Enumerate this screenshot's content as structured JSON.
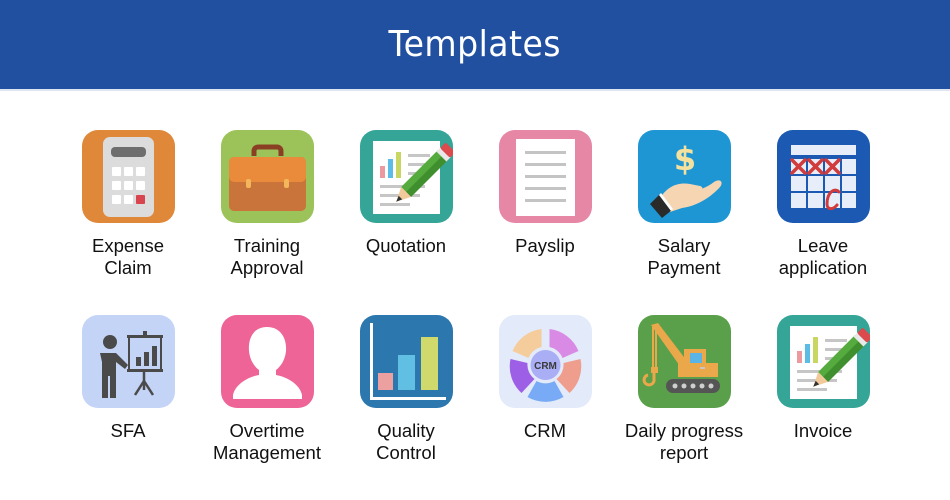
{
  "header": {
    "title": "Templates",
    "background": "#2150a1"
  },
  "templates": [
    {
      "id": "expense-claim",
      "lines": [
        "Expense",
        "Claim"
      ],
      "icon": "calculator-icon",
      "color": "#e0883a"
    },
    {
      "id": "training-approval",
      "lines": [
        "Training",
        "Approval"
      ],
      "icon": "briefcase-icon",
      "color": "#9cc35a"
    },
    {
      "id": "quotation",
      "lines": [
        "Quotation"
      ],
      "icon": "document-pencil-icon",
      "color": "#35a597"
    },
    {
      "id": "payslip",
      "lines": [
        "Payslip"
      ],
      "icon": "document-icon",
      "color": "#e687a6"
    },
    {
      "id": "salary-payment",
      "lines": [
        "Salary",
        "Payment"
      ],
      "icon": "hand-dollar-icon",
      "color": "#1e96d4"
    },
    {
      "id": "leave-application",
      "lines": [
        "Leave",
        "application"
      ],
      "icon": "calendar-icon",
      "color": "#1b59b3"
    },
    {
      "id": "sfa",
      "lines": [
        "SFA"
      ],
      "icon": "presentation-icon",
      "color": "#c4d4f7"
    },
    {
      "id": "overtime-management",
      "lines": [
        "Overtime",
        "Management"
      ],
      "icon": "person-icon",
      "color": "#ee6496"
    },
    {
      "id": "quality-control",
      "lines": [
        "Quality",
        "Control"
      ],
      "icon": "bar-chart-icon",
      "color": "#2b77ae"
    },
    {
      "id": "crm",
      "lines": [
        "CRM"
      ],
      "icon": "crm-wheel-icon",
      "color": "#e3eafa",
      "icon_text": "CRM"
    },
    {
      "id": "daily-progress-report",
      "lines": [
        "Daily progress",
        "report"
      ],
      "icon": "crane-icon",
      "color": "#5aa04a"
    },
    {
      "id": "invoice",
      "lines": [
        "Invoice"
      ],
      "icon": "document-pencil-icon",
      "color": "#35a597"
    }
  ]
}
